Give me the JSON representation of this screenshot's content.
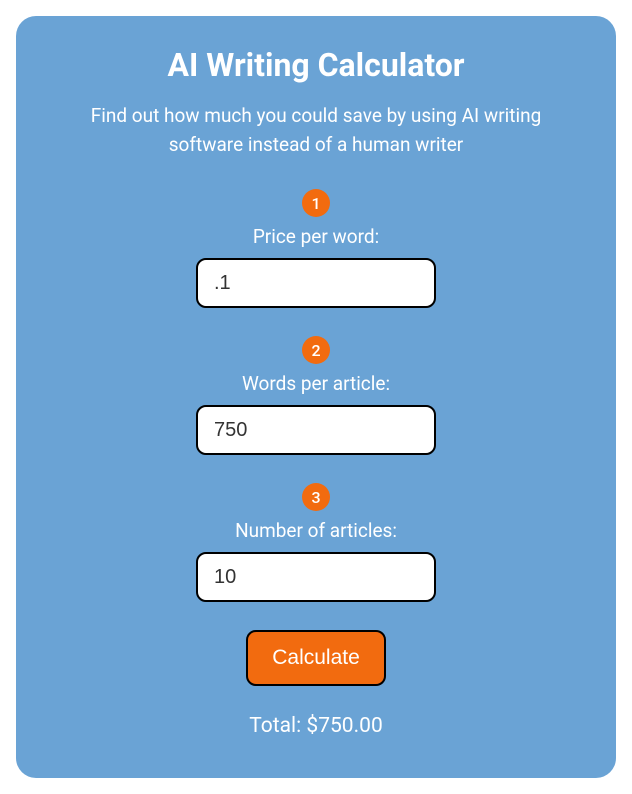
{
  "header": {
    "title": "AI Writing Calculator",
    "subtitle": "Find out how much you could save by using AI writing software instead of a human writer"
  },
  "steps": [
    {
      "badge": "1",
      "label": "Price per word:",
      "value": ".1"
    },
    {
      "badge": "2",
      "label": "Words per article:",
      "value": "750"
    },
    {
      "badge": "3",
      "label": "Number of articles:",
      "value": "10"
    }
  ],
  "button": {
    "label": "Calculate"
  },
  "result": {
    "total_label": "Total: $750.00"
  },
  "colors": {
    "card_bg": "#6aa3d5",
    "accent": "#f26b0f"
  }
}
